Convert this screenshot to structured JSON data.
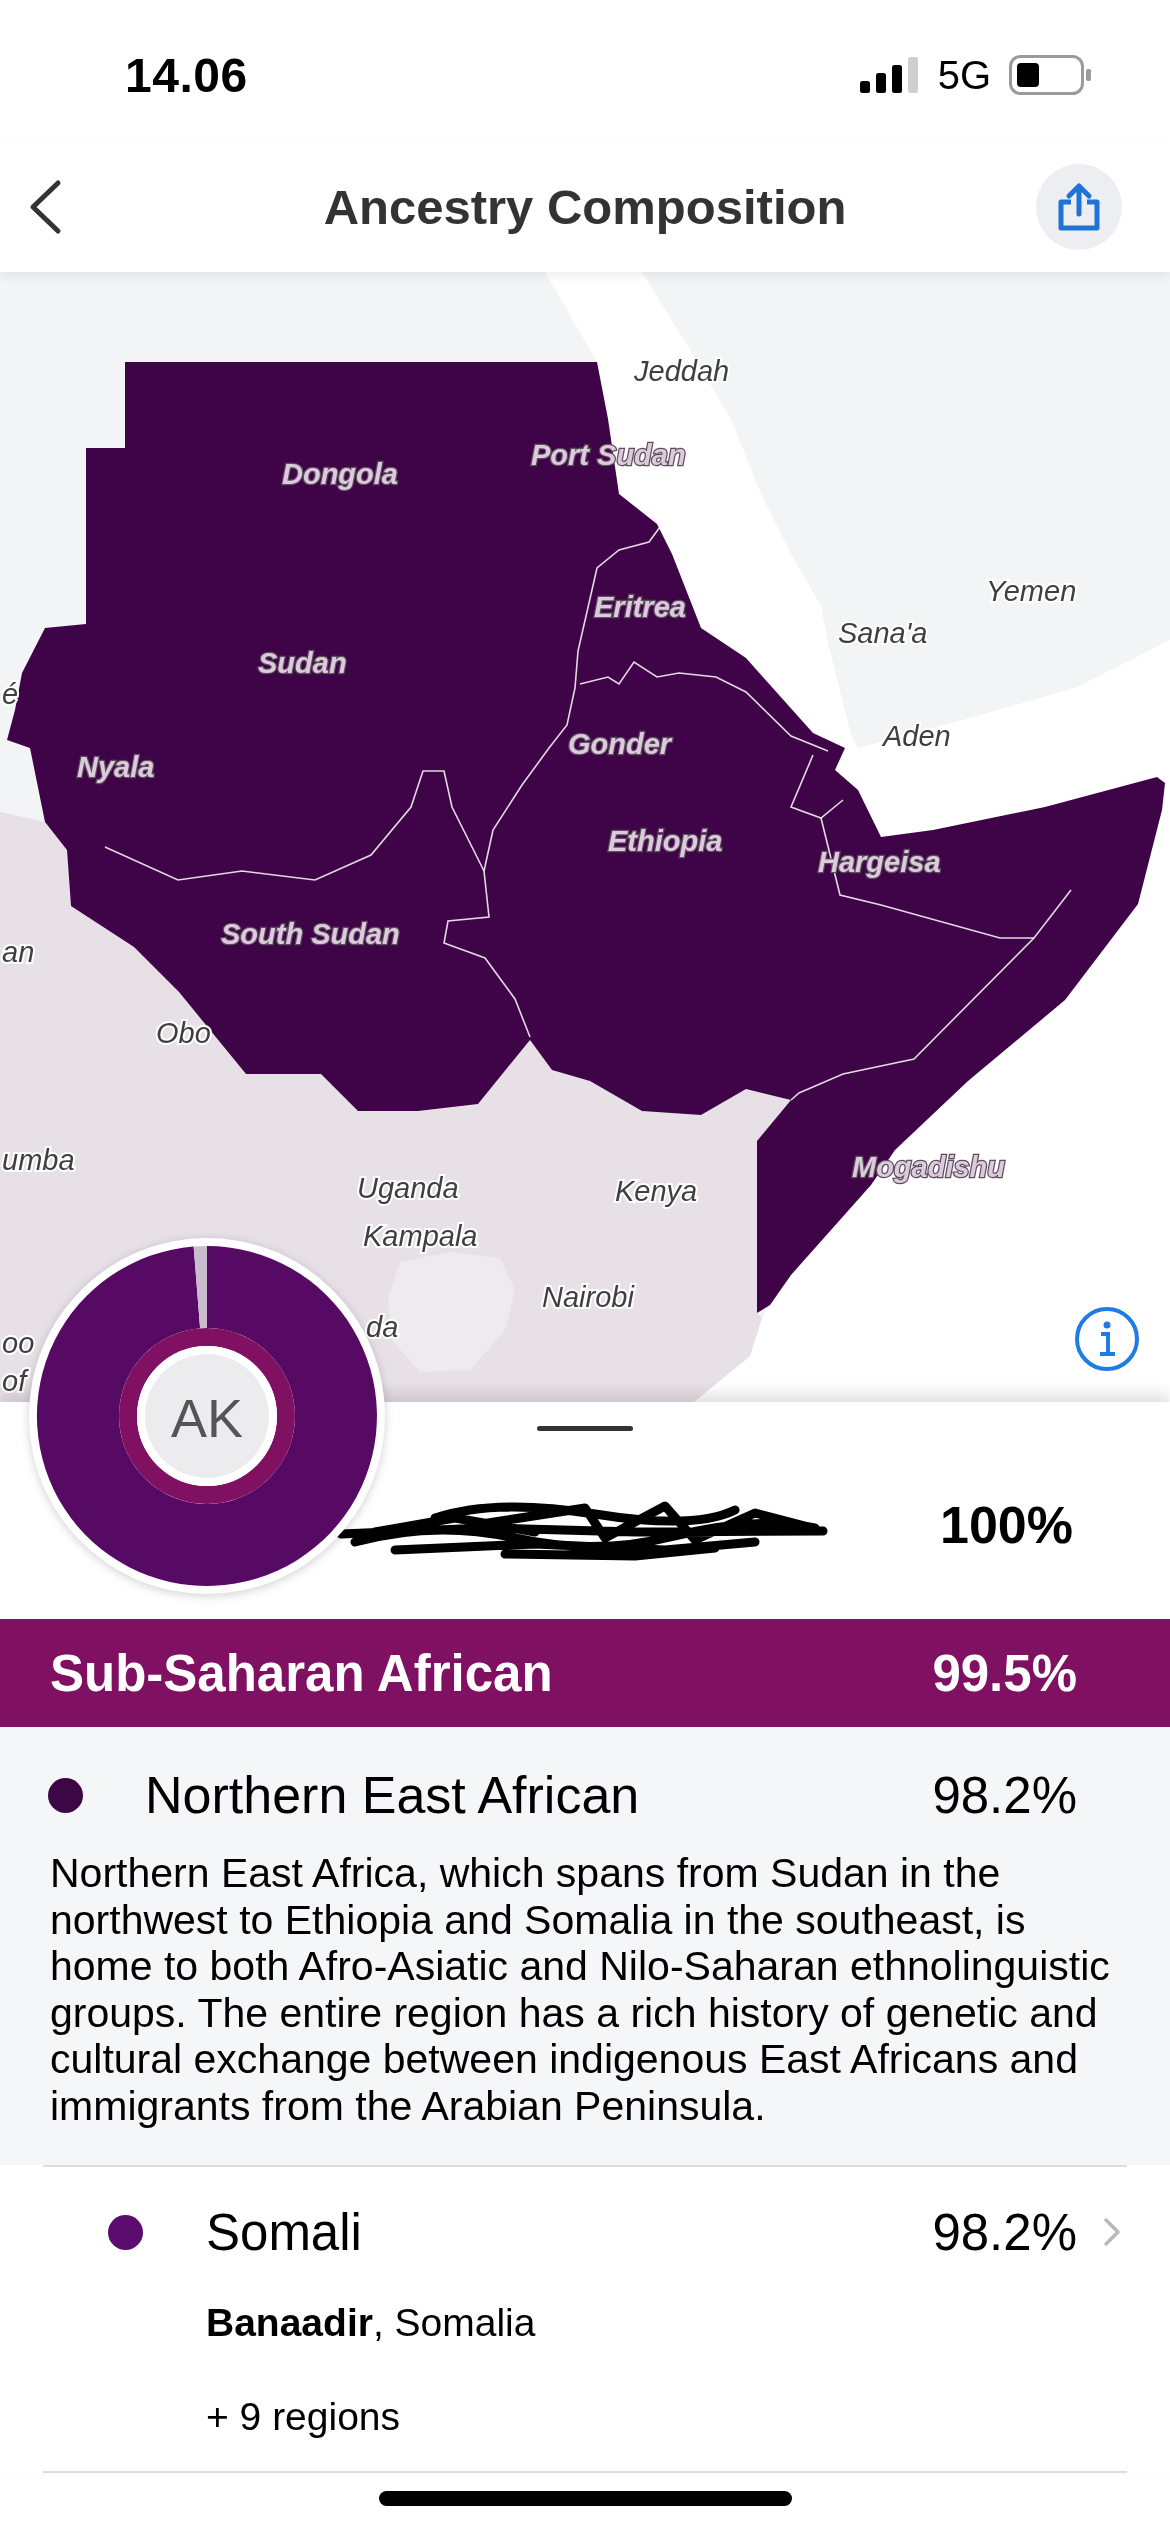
{
  "status_bar": {
    "time": "14.06",
    "network": "5G"
  },
  "header": {
    "title": "Ancestry Composition"
  },
  "map": {
    "labels": [
      {
        "text": "Jeddah",
        "kind": "plain"
      },
      {
        "text": "Port Sudan",
        "kind": "highlighted"
      },
      {
        "text": "Dongola",
        "kind": "highlighted"
      },
      {
        "text": "Yemen",
        "kind": "plain"
      },
      {
        "text": "Eritrea",
        "kind": "highlighted"
      },
      {
        "text": "Sana'a",
        "kind": "plain"
      },
      {
        "text": "Sudan",
        "kind": "highlighted"
      },
      {
        "text": "é",
        "kind": "plain"
      },
      {
        "text": "Aden",
        "kind": "plain"
      },
      {
        "text": "Gonder",
        "kind": "highlighted"
      },
      {
        "text": "Nyala",
        "kind": "highlighted"
      },
      {
        "text": "Ethiopia",
        "kind": "highlighted"
      },
      {
        "text": "Hargeisa",
        "kind": "highlighted"
      },
      {
        "text": "South Sudan",
        "kind": "highlighted"
      },
      {
        "text": "an",
        "kind": "plain"
      },
      {
        "text": "Obo",
        "kind": "plain"
      },
      {
        "text": "umba",
        "kind": "plain"
      },
      {
        "text": "Mogadishu",
        "kind": "highlighted"
      },
      {
        "text": "Uganda",
        "kind": "plain"
      },
      {
        "text": "Kenya",
        "kind": "plain"
      },
      {
        "text": "Kampala",
        "kind": "plain"
      },
      {
        "text": "Nairobi",
        "kind": "plain"
      },
      {
        "text": "da",
        "kind": "plain"
      },
      {
        "text": "oo",
        "kind": "plain"
      },
      {
        "text": "of",
        "kind": "plain"
      }
    ]
  },
  "profile": {
    "initials": "AK",
    "total": "100%"
  },
  "summary": {
    "name": "Sub-Saharan African",
    "percent": "99.5%"
  },
  "breakdown": [
    {
      "kind": "region",
      "name": "Northern East African",
      "percent": "98.2%",
      "color": "#3d0745",
      "description": "Northern East Africa, which spans from Sudan in the northwest to Ethiopia and Somalia in the southeast, is home to both Afro-Asiatic and Nilo-Saharan ethnolinguistic groups. The entire region has a rich history of genetic and cultural exchange between indigenous East Africans and immigrants from the Arabian Peninsula."
    },
    {
      "kind": "population",
      "name": "Somali",
      "percent": "98.2%",
      "color": "#5c0b6e",
      "location": "**Banaadir**, Somalia",
      "more": "+ 9 regions"
    }
  ]
}
